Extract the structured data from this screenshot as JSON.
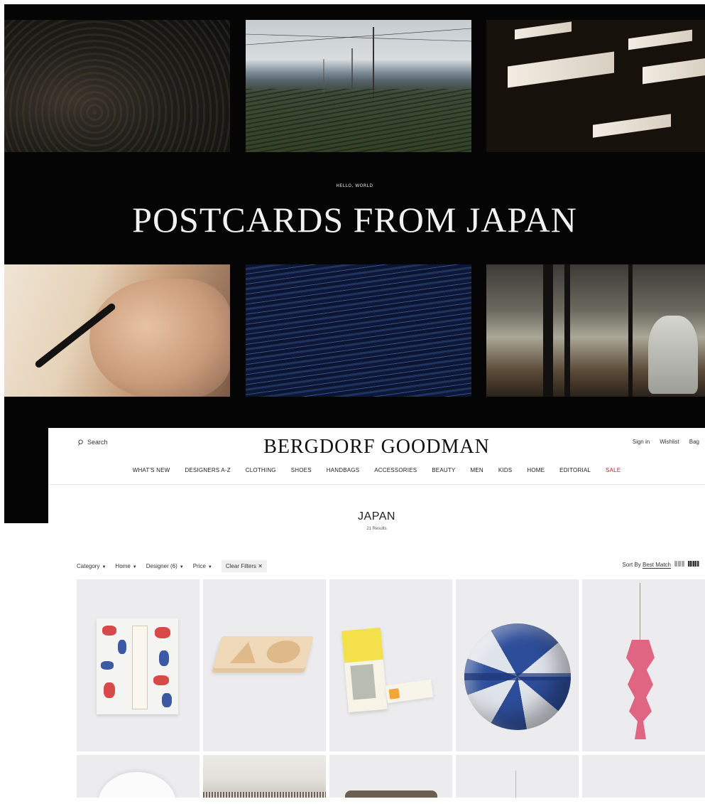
{
  "hero": {
    "kicker": "HELLO, WORLD",
    "title": "POSTCARDS FROM JAPAN"
  },
  "header": {
    "search_label": "Search",
    "logo": "BERGDORF GOODMAN",
    "utility": [
      "Sign in",
      "Wishlist",
      "Bag"
    ]
  },
  "nav": [
    "WHAT'S NEW",
    "DESIGNERS A-Z",
    "CLOTHING",
    "SHOES",
    "HANDBAGS",
    "ACCESSORIES",
    "BEAUTY",
    "MEN",
    "KIDS",
    "HOME",
    "EDITORIAL",
    "SALE"
  ],
  "page": {
    "title": "JAPAN",
    "results": "21 Results"
  },
  "filters": {
    "category": "Category",
    "home": "Home",
    "designer": "Designer (6)",
    "price": "Price",
    "clear": "Clear Filters ✕"
  },
  "sort": {
    "label": "Sort By",
    "value": "Best Match"
  },
  "colors": {
    "sale": "#c0282a",
    "card_bg": "#ececef",
    "hero_bg": "#050505"
  },
  "products": [
    {
      "icon": "towel-product-image"
    },
    {
      "icon": "onigiri-tray-product-image"
    },
    {
      "icon": "tea-set-product-image"
    },
    {
      "icon": "bento-ball-product-image"
    },
    {
      "icon": "koinobori-product-image"
    },
    {
      "icon": "bowl-product-image"
    },
    {
      "icon": "fabric-product-image"
    },
    {
      "icon": "cushion-product-image"
    },
    {
      "icon": "hanging-product-image"
    },
    {
      "icon": "product-image"
    }
  ]
}
